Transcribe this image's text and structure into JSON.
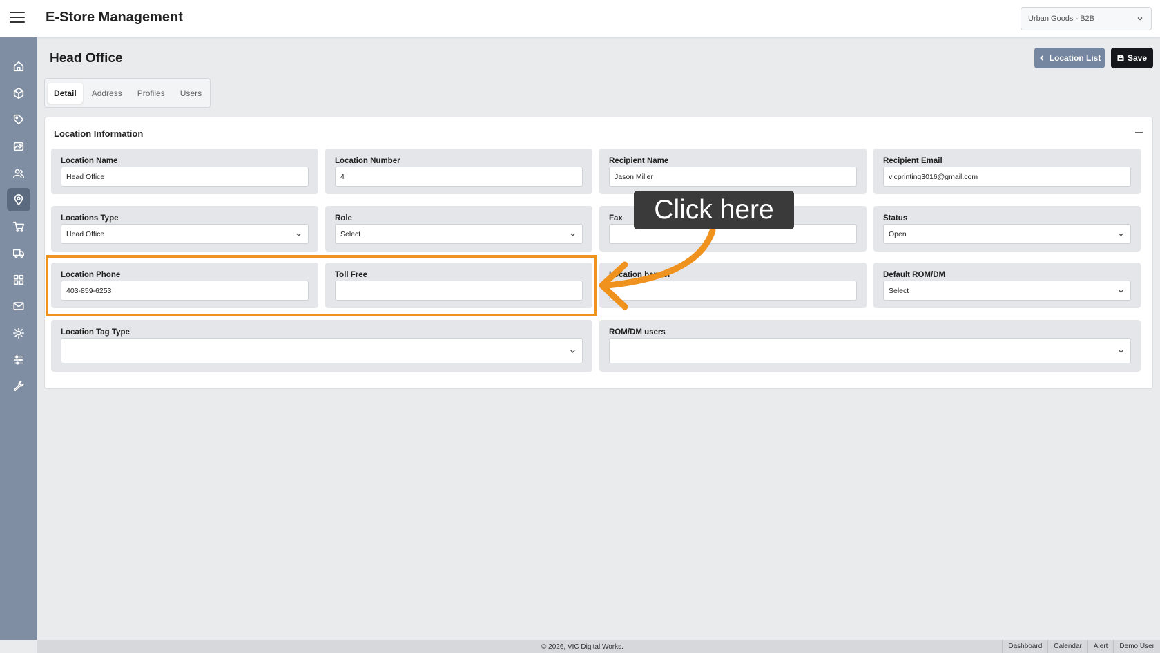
{
  "header": {
    "app_title": "E-Store Management",
    "store_selector": "Urban Goods - B2B"
  },
  "sidebar": {
    "items": [
      {
        "icon": "home-icon"
      },
      {
        "icon": "box-icon"
      },
      {
        "icon": "tag-icon"
      },
      {
        "icon": "image-icon"
      },
      {
        "icon": "users-icon"
      },
      {
        "icon": "location-pin-icon",
        "active": true
      },
      {
        "icon": "cart-icon"
      },
      {
        "icon": "truck-icon"
      },
      {
        "icon": "grid-icon"
      },
      {
        "icon": "mail-icon"
      },
      {
        "icon": "gear-icon"
      },
      {
        "icon": "sliders-icon"
      },
      {
        "icon": "wrench-icon"
      }
    ]
  },
  "page": {
    "title": "Head Office",
    "location_list_label": "Location List",
    "save_label": "Save"
  },
  "tabs": [
    "Detail",
    "Address",
    "Profiles",
    "Users"
  ],
  "card": {
    "title": "Location Information",
    "fields": {
      "location_name": {
        "label": "Location Name",
        "value": "Head Office"
      },
      "location_number": {
        "label": "Location Number",
        "value": "4"
      },
      "recipient_name": {
        "label": "Recipient Name",
        "value": "Jason Miller"
      },
      "recipient_email": {
        "label": "Recipient Email",
        "value": "vicprinting3016@gmail.com"
      },
      "locations_type": {
        "label": "Locations Type",
        "value": "Head Office"
      },
      "role": {
        "label": "Role",
        "value": "Select"
      },
      "fax": {
        "label": "Fax",
        "value": ""
      },
      "status": {
        "label": "Status",
        "value": "Open"
      },
      "location_phone": {
        "label": "Location Phone",
        "value": "403-859-6253"
      },
      "toll_free": {
        "label": "Toll Free",
        "value": ""
      },
      "location_banner": {
        "label": "Location banner",
        "value": ""
      },
      "default_rom_dm": {
        "label": "Default ROM/DM",
        "value": "Select"
      },
      "location_tag_type": {
        "label": "Location Tag Type",
        "value": ""
      },
      "rom_dm_users": {
        "label": "ROM/DM users",
        "value": ""
      }
    }
  },
  "annotation": {
    "callout": "Click here",
    "color": "#f0921e"
  },
  "footer": {
    "copyright": "© 2026, VIC Digital Works.",
    "links": [
      "Dashboard",
      "Calendar",
      "Alert",
      "Demo User"
    ]
  }
}
